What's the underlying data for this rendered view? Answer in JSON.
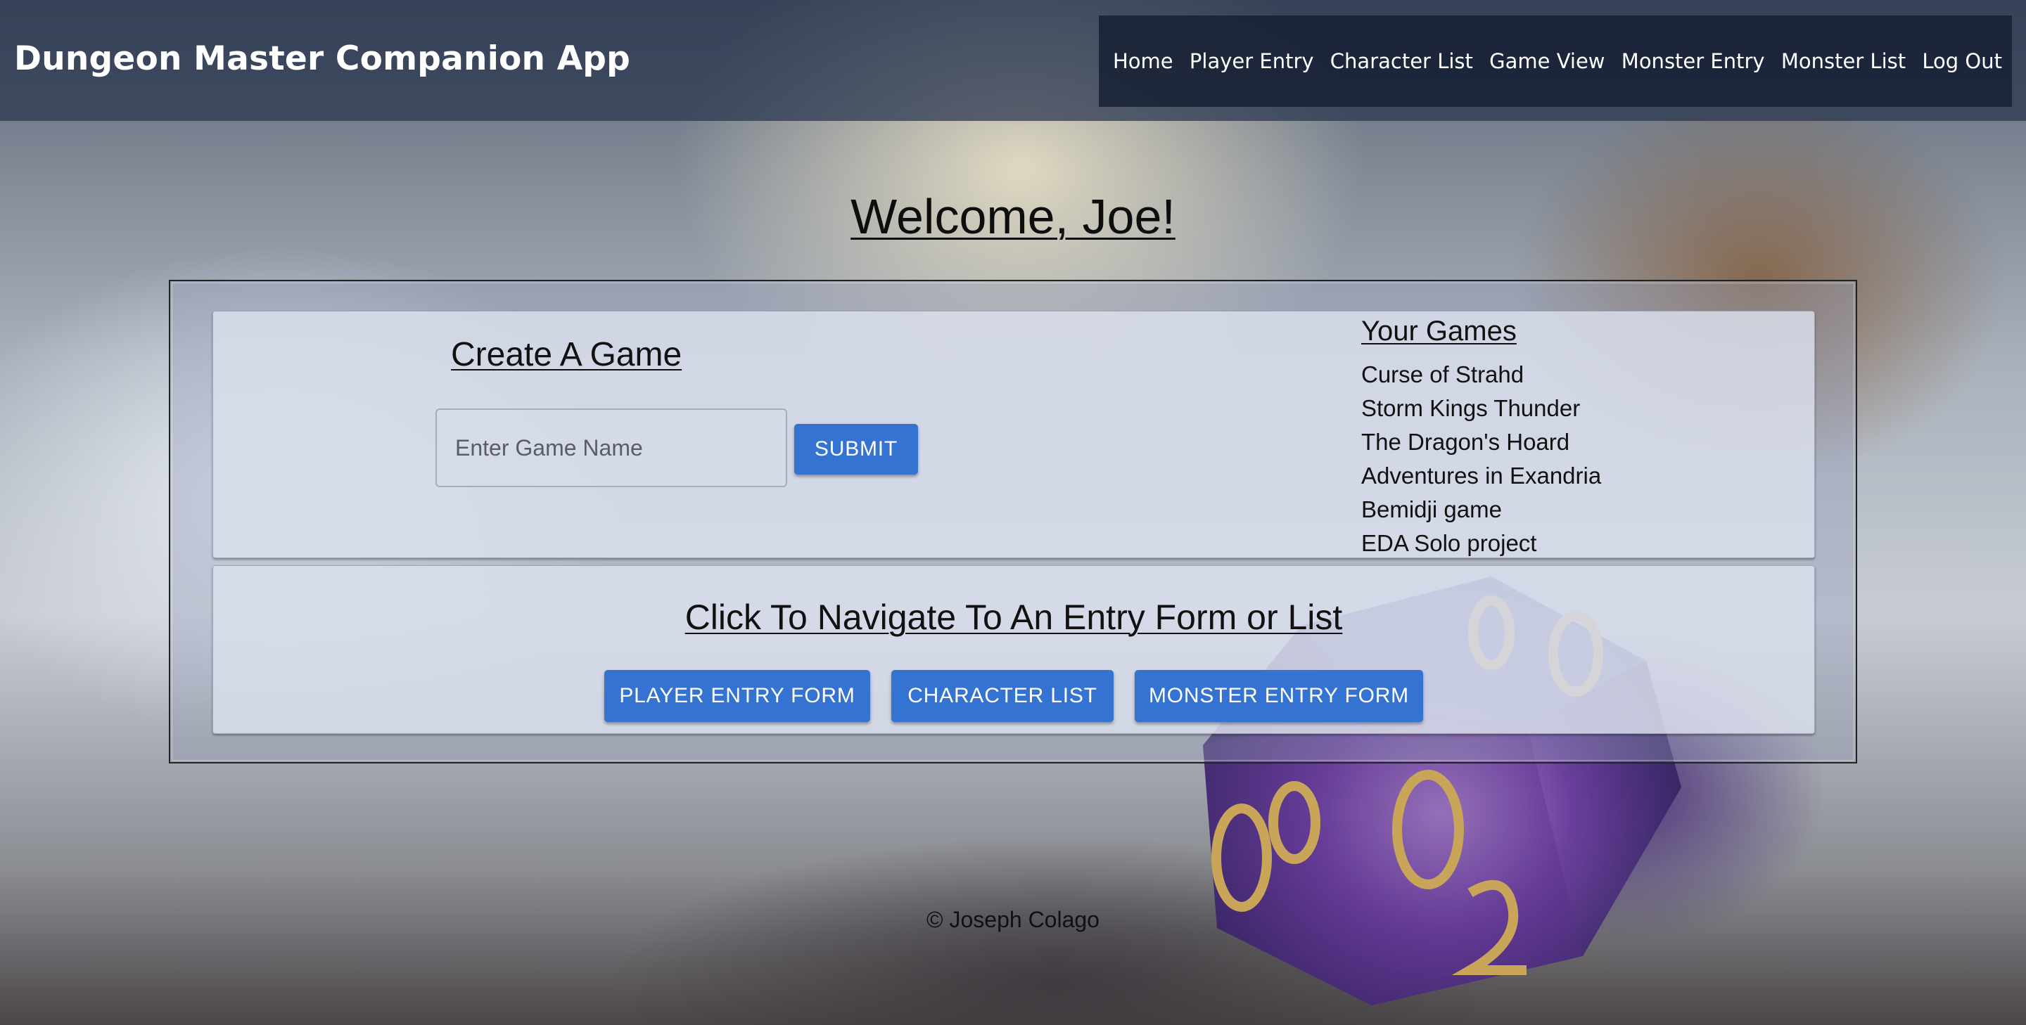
{
  "header": {
    "brand": "Dungeon Master Companion App",
    "nav": [
      {
        "label": "Home"
      },
      {
        "label": "Player Entry"
      },
      {
        "label": "Character List"
      },
      {
        "label": "Game View"
      },
      {
        "label": "Monster Entry"
      },
      {
        "label": "Monster List"
      },
      {
        "label": "Log Out"
      }
    ]
  },
  "welcome": "Welcome, Joe!",
  "create_game": {
    "title": "Create A Game",
    "input_placeholder": "Enter Game Name",
    "input_value": "",
    "submit_label": "SUBMIT"
  },
  "your_games": {
    "title": "Your Games",
    "items": [
      "Curse of Strahd",
      "Storm Kings Thunder",
      "The Dragon's Hoard",
      "Adventures in Exandria",
      "Bemidji game",
      "EDA Solo project"
    ]
  },
  "navigate": {
    "title": "Click To Navigate To An Entry Form or List",
    "buttons": [
      {
        "label": "PLAYER ENTRY FORM"
      },
      {
        "label": "CHARACTER LIST"
      },
      {
        "label": "MONSTER ENTRY FORM"
      }
    ]
  },
  "background": {
    "icon": "dice-icon",
    "accent_color": "#3473d1",
    "header_color": "#283450",
    "nav_color": "#161e32"
  },
  "footer": "© Joseph Colago"
}
